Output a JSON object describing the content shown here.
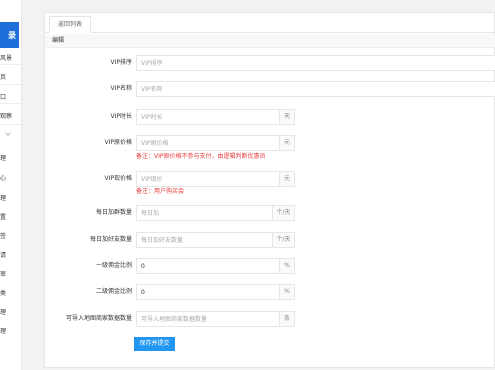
{
  "sidebar": {
    "logo_text": "录",
    "items": [
      "风景",
      "页",
      "口",
      "观察",
      "理",
      "心",
      "理",
      "置",
      "签",
      "请",
      "审",
      "类",
      "理",
      "理"
    ]
  },
  "tab": {
    "label": "返回列表"
  },
  "panel": {
    "title": "编辑"
  },
  "form": {
    "vip_sort": {
      "label": "VIP排序",
      "placeholder": "VIP排序"
    },
    "vip_name": {
      "label": "VIP名称",
      "placeholder": "VIP名称"
    },
    "vip_duration": {
      "label": "VIP时长",
      "placeholder": "VIP时长",
      "suffix": "天"
    },
    "vip_original_price": {
      "label": "VIP原价格",
      "placeholder": "VIP原价格",
      "suffix": "元",
      "note": "备注：VIP原价格不参与支付，由逻辑判断优惠员"
    },
    "vip_current_price": {
      "label": "VIP现价格",
      "placeholder": "VIP现价",
      "suffix": "元",
      "note": "备注：用户购买会"
    },
    "daily_add_count": {
      "label": "每日加群数量",
      "placeholder": "每日加",
      "suffix": "个/天"
    },
    "daily_friend_count": {
      "label": "每日加好友数量",
      "placeholder": "每日加好友数量",
      "suffix": "个/天"
    },
    "level1_commission": {
      "label": "一级佣金比例",
      "value": "0",
      "suffix": "%"
    },
    "level2_commission": {
      "label": "二级佣金比例",
      "value": "0",
      "suffix": "%"
    },
    "import_limit": {
      "label": "可导入地图商家数据数量",
      "placeholder": "可导入地图商家数据数量",
      "suffix": "条"
    }
  },
  "submit": {
    "label": "保存并提交"
  },
  "colors": {
    "accent": "#2196f3",
    "note": "#e83a3a",
    "logo": "#1e6fd9"
  }
}
